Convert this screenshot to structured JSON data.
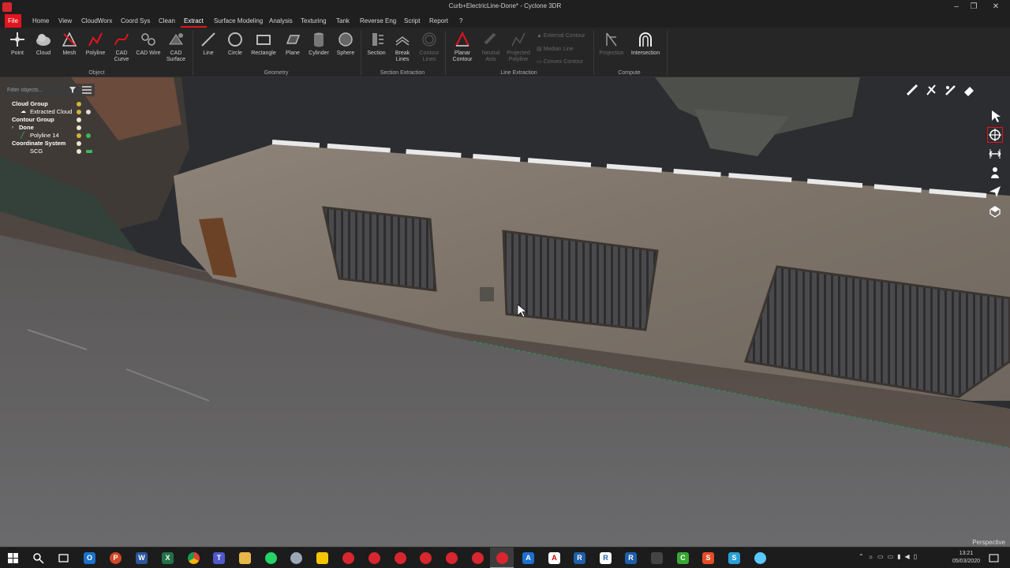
{
  "window": {
    "title": "Curb+ElectricLine-Done* - Cyclone 3DR",
    "controls": [
      "–",
      "❐",
      "✕"
    ]
  },
  "menu": {
    "items": [
      "File",
      "Home",
      "View",
      "CloudWorx",
      "Coord Sys",
      "Clean",
      "Extract",
      "Surface Modeling",
      "Analysis",
      "Texturing",
      "Tank",
      "Reverse Eng",
      "Script",
      "Report",
      "?"
    ],
    "active": "Extract"
  },
  "ribbon": {
    "object": {
      "label": "Object",
      "buttons": [
        "Point",
        "Cloud",
        "Mesh",
        "Polyline",
        "CAD\nCurve",
        "CAD Wire",
        "CAD\nSurface"
      ]
    },
    "geometry": {
      "label": "Geometry",
      "buttons": [
        "Line",
        "Circle",
        "Rectangle",
        "Plane",
        "Cylinder",
        "Sphere"
      ]
    },
    "section_extraction": {
      "label": "Section Extraction",
      "buttons": [
        "Section",
        "Break\nLines",
        "Contour\nLines"
      ]
    },
    "line_extraction": {
      "label": "Line Extraction",
      "buttons": [
        "Planar\nContour",
        "Neutral\nAxis",
        "Projected\nPolyline"
      ],
      "small": [
        "External Contour",
        "Median Line",
        "Convex Contour"
      ]
    },
    "compute": {
      "label": "Compute",
      "buttons": [
        "Projection",
        "Intersection"
      ]
    }
  },
  "tree": {
    "filter_placeholder": "Filter objects...",
    "rows": [
      {
        "label": "Cloud Group",
        "bold": true
      },
      {
        "label": "Extracted Cloud",
        "bold": false
      },
      {
        "label": "Contour Group",
        "bold": true
      },
      {
        "label": "Done",
        "bold": true
      },
      {
        "label": "Polyline 14",
        "bold": false
      },
      {
        "label": "Coordinate System",
        "bold": true
      },
      {
        "label": "SCG",
        "bold": false
      }
    ]
  },
  "viewport": {
    "projection": "Perspective"
  },
  "taskbar": {
    "time": "13:21",
    "date": "05/03/2020"
  },
  "colors": {
    "accent": "#e3141f",
    "ribbon_bg": "#262626",
    "titlebar_bg": "#1f1f1f"
  }
}
